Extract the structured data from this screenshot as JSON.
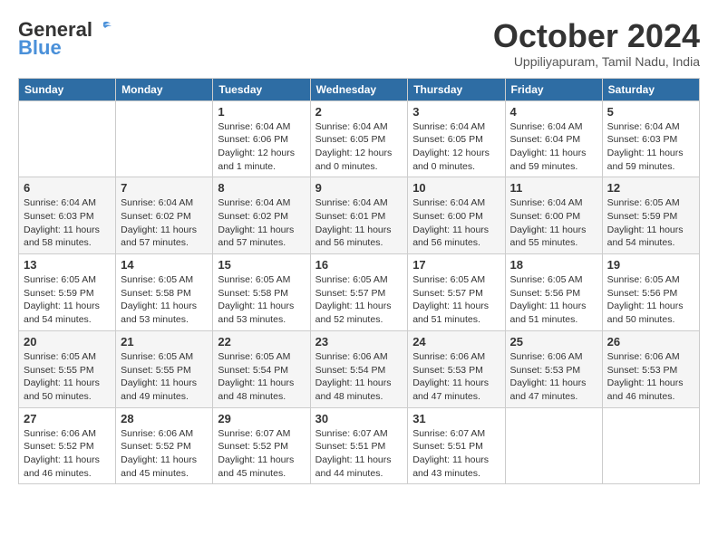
{
  "header": {
    "logo_general": "General",
    "logo_blue": "Blue",
    "title": "October 2024",
    "location": "Uppiliyapuram, Tamil Nadu, India"
  },
  "weekdays": [
    "Sunday",
    "Monday",
    "Tuesday",
    "Wednesday",
    "Thursday",
    "Friday",
    "Saturday"
  ],
  "weeks": [
    [
      {
        "day": "",
        "info": ""
      },
      {
        "day": "",
        "info": ""
      },
      {
        "day": "1",
        "info": "Sunrise: 6:04 AM\nSunset: 6:06 PM\nDaylight: 12 hours\nand 1 minute."
      },
      {
        "day": "2",
        "info": "Sunrise: 6:04 AM\nSunset: 6:05 PM\nDaylight: 12 hours\nand 0 minutes."
      },
      {
        "day": "3",
        "info": "Sunrise: 6:04 AM\nSunset: 6:05 PM\nDaylight: 12 hours\nand 0 minutes."
      },
      {
        "day": "4",
        "info": "Sunrise: 6:04 AM\nSunset: 6:04 PM\nDaylight: 11 hours\nand 59 minutes."
      },
      {
        "day": "5",
        "info": "Sunrise: 6:04 AM\nSunset: 6:03 PM\nDaylight: 11 hours\nand 59 minutes."
      }
    ],
    [
      {
        "day": "6",
        "info": "Sunrise: 6:04 AM\nSunset: 6:03 PM\nDaylight: 11 hours\nand 58 minutes."
      },
      {
        "day": "7",
        "info": "Sunrise: 6:04 AM\nSunset: 6:02 PM\nDaylight: 11 hours\nand 57 minutes."
      },
      {
        "day": "8",
        "info": "Sunrise: 6:04 AM\nSunset: 6:02 PM\nDaylight: 11 hours\nand 57 minutes."
      },
      {
        "day": "9",
        "info": "Sunrise: 6:04 AM\nSunset: 6:01 PM\nDaylight: 11 hours\nand 56 minutes."
      },
      {
        "day": "10",
        "info": "Sunrise: 6:04 AM\nSunset: 6:00 PM\nDaylight: 11 hours\nand 56 minutes."
      },
      {
        "day": "11",
        "info": "Sunrise: 6:04 AM\nSunset: 6:00 PM\nDaylight: 11 hours\nand 55 minutes."
      },
      {
        "day": "12",
        "info": "Sunrise: 6:05 AM\nSunset: 5:59 PM\nDaylight: 11 hours\nand 54 minutes."
      }
    ],
    [
      {
        "day": "13",
        "info": "Sunrise: 6:05 AM\nSunset: 5:59 PM\nDaylight: 11 hours\nand 54 minutes."
      },
      {
        "day": "14",
        "info": "Sunrise: 6:05 AM\nSunset: 5:58 PM\nDaylight: 11 hours\nand 53 minutes."
      },
      {
        "day": "15",
        "info": "Sunrise: 6:05 AM\nSunset: 5:58 PM\nDaylight: 11 hours\nand 53 minutes."
      },
      {
        "day": "16",
        "info": "Sunrise: 6:05 AM\nSunset: 5:57 PM\nDaylight: 11 hours\nand 52 minutes."
      },
      {
        "day": "17",
        "info": "Sunrise: 6:05 AM\nSunset: 5:57 PM\nDaylight: 11 hours\nand 51 minutes."
      },
      {
        "day": "18",
        "info": "Sunrise: 6:05 AM\nSunset: 5:56 PM\nDaylight: 11 hours\nand 51 minutes."
      },
      {
        "day": "19",
        "info": "Sunrise: 6:05 AM\nSunset: 5:56 PM\nDaylight: 11 hours\nand 50 minutes."
      }
    ],
    [
      {
        "day": "20",
        "info": "Sunrise: 6:05 AM\nSunset: 5:55 PM\nDaylight: 11 hours\nand 50 minutes."
      },
      {
        "day": "21",
        "info": "Sunrise: 6:05 AM\nSunset: 5:55 PM\nDaylight: 11 hours\nand 49 minutes."
      },
      {
        "day": "22",
        "info": "Sunrise: 6:05 AM\nSunset: 5:54 PM\nDaylight: 11 hours\nand 48 minutes."
      },
      {
        "day": "23",
        "info": "Sunrise: 6:06 AM\nSunset: 5:54 PM\nDaylight: 11 hours\nand 48 minutes."
      },
      {
        "day": "24",
        "info": "Sunrise: 6:06 AM\nSunset: 5:53 PM\nDaylight: 11 hours\nand 47 minutes."
      },
      {
        "day": "25",
        "info": "Sunrise: 6:06 AM\nSunset: 5:53 PM\nDaylight: 11 hours\nand 47 minutes."
      },
      {
        "day": "26",
        "info": "Sunrise: 6:06 AM\nSunset: 5:53 PM\nDaylight: 11 hours\nand 46 minutes."
      }
    ],
    [
      {
        "day": "27",
        "info": "Sunrise: 6:06 AM\nSunset: 5:52 PM\nDaylight: 11 hours\nand 46 minutes."
      },
      {
        "day": "28",
        "info": "Sunrise: 6:06 AM\nSunset: 5:52 PM\nDaylight: 11 hours\nand 45 minutes."
      },
      {
        "day": "29",
        "info": "Sunrise: 6:07 AM\nSunset: 5:52 PM\nDaylight: 11 hours\nand 45 minutes."
      },
      {
        "day": "30",
        "info": "Sunrise: 6:07 AM\nSunset: 5:51 PM\nDaylight: 11 hours\nand 44 minutes."
      },
      {
        "day": "31",
        "info": "Sunrise: 6:07 AM\nSunset: 5:51 PM\nDaylight: 11 hours\nand 43 minutes."
      },
      {
        "day": "",
        "info": ""
      },
      {
        "day": "",
        "info": ""
      }
    ]
  ]
}
